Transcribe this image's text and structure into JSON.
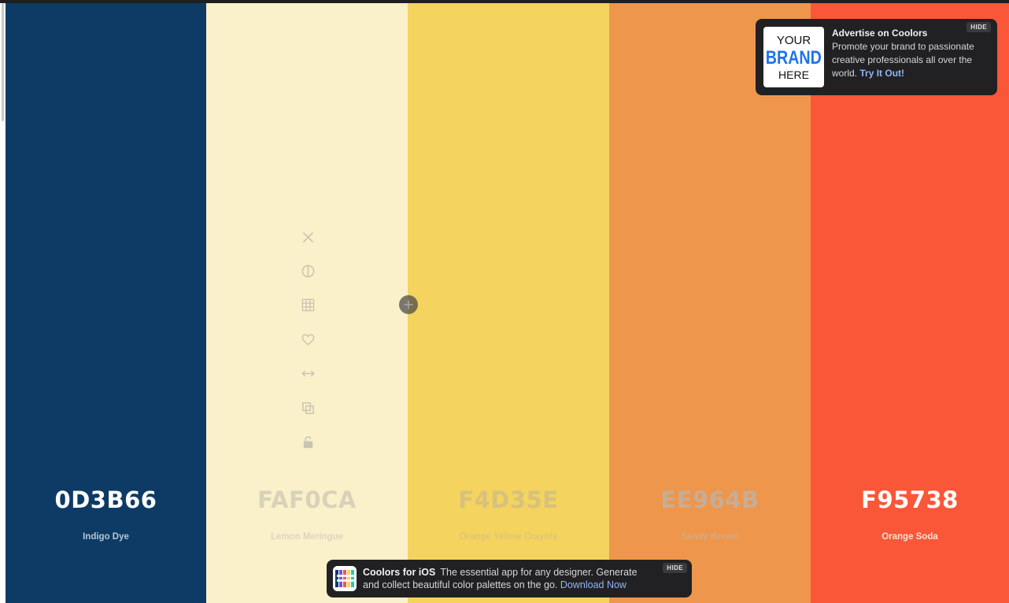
{
  "palette": [
    {
      "hex": "0D3B66",
      "name": "Indigo Dye",
      "bg": "#0D3B66",
      "text_color": "#ffffff",
      "name_color": "#b9c7d6"
    },
    {
      "hex": "FAF0CA",
      "name": "Lemon Meringue",
      "bg": "#FAF0CA",
      "text_color": "#d8d2b9",
      "name_color": "#dcd6bd"
    },
    {
      "hex": "F4D35E",
      "name": "Orange Yellow Crayola",
      "bg": "#F4D35E",
      "text_color": "#d6c27e",
      "name_color": "#dcc674"
    },
    {
      "hex": "EE964B",
      "name": "Sandy Brown",
      "bg": "#EE964B",
      "text_color": "#c7ad96",
      "name_color": "#d8a980"
    },
    {
      "hex": "F95738",
      "name": "Orange Soda",
      "bg": "#F95738",
      "text_color": "#ffffff",
      "name_color": "#fde0d8"
    }
  ],
  "tools": [
    {
      "name": "remove-color-button",
      "icon": "close-icon"
    },
    {
      "name": "shades-button",
      "icon": "contrast-icon"
    },
    {
      "name": "view-shades-button",
      "icon": "grid-icon"
    },
    {
      "name": "save-color-button",
      "icon": "heart-icon"
    },
    {
      "name": "drag-button",
      "icon": "drag-arrows-icon"
    },
    {
      "name": "copy-hex-button",
      "icon": "copy-icon"
    },
    {
      "name": "lock-color-button",
      "icon": "unlock-icon"
    }
  ],
  "tool_color": "#c9c4b1",
  "ad": {
    "logo_line1": "YOUR",
    "logo_line2": "BRAND",
    "logo_line3": "HERE",
    "title": "Advertise on Coolors",
    "body": "Promote your brand to passionate creative professionals all over the world.",
    "link": "Try It Out!",
    "hide": "HIDE"
  },
  "ios_banner": {
    "title": "Coolors for iOS",
    "body": "The essential app for any designer. Generate and collect beautiful color palettes on the go.",
    "link": "Download Now",
    "hide": "HIDE"
  }
}
